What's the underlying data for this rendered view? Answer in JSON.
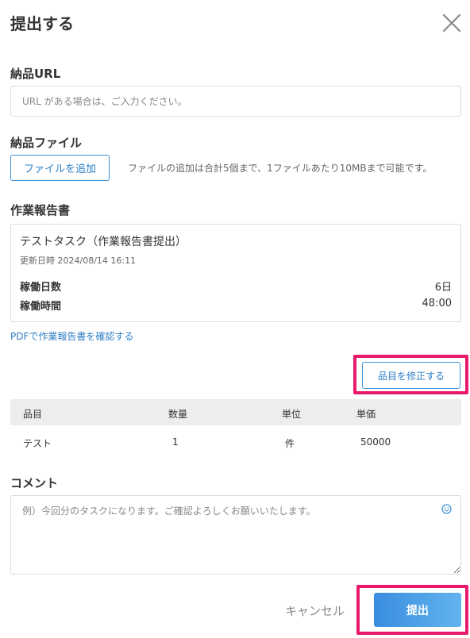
{
  "modal": {
    "title": "提出する"
  },
  "url_section": {
    "label": "納品URL",
    "placeholder": "URL がある場合は、ご入力ください。",
    "value": ""
  },
  "file_section": {
    "label": "納品ファイル",
    "button_label": "ファイルを追加",
    "hint": "ファイルの追加は合計5個まで、1ファイルあたり10MBまで可能です。"
  },
  "report_section": {
    "label": "作業報告書",
    "card": {
      "title": "テストタスク（作業報告書提出）",
      "updated": "更新日時 2024/08/14 16:11",
      "days_label": "稼働日数",
      "days_value": "6日",
      "hours_label": "稼働時間",
      "hours_value": "48:00"
    },
    "pdf_link": "PDFで作業報告書を確認する"
  },
  "items_section": {
    "edit_button": "品目を修正する",
    "columns": [
      "品目",
      "数量",
      "単位",
      "単価"
    ],
    "rows": [
      [
        "テスト",
        "1",
        "件",
        "50000"
      ]
    ]
  },
  "comment_section": {
    "label": "コメント",
    "placeholder": "例）今回分のタスクになります。ご確認よろしくお願いいたします。",
    "value": "",
    "emoji_icon": "smiley-icon"
  },
  "footer": {
    "cancel_label": "キャンセル",
    "submit_label": "提出"
  },
  "colors": {
    "accent": "#2f7fc5",
    "highlight": "#e8196b",
    "table_header_bg": "#ededed"
  }
}
